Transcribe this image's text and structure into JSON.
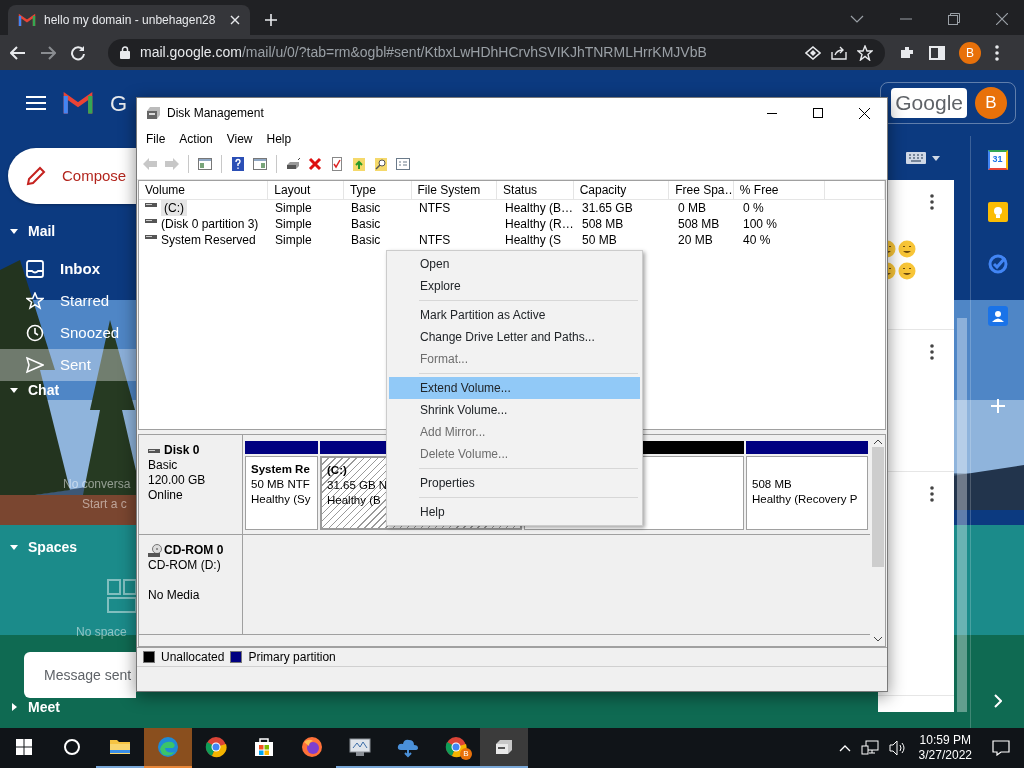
{
  "browser": {
    "tab_title": "hello my domain - unbehagen28",
    "url_host": "mail.google.com",
    "url_path": "/mail/u/0/?tab=rm&ogbl#sent/KtbxLwHDhHCrvhSVIKJhTNRMLHrrKMJVbB",
    "profile": "B"
  },
  "gmail": {
    "logo_text": "G",
    "compose": "Compose",
    "google_badge": "Google",
    "avatar": "B",
    "calendar_day": "31",
    "toast": "Message sent",
    "sidebar": [
      {
        "kind": "section",
        "label": "Mail",
        "expanded": true
      },
      {
        "kind": "nav",
        "label": "Inbox",
        "unread": true,
        "selected": false
      },
      {
        "kind": "nav",
        "label": "Starred",
        "unread": false,
        "selected": false
      },
      {
        "kind": "nav",
        "label": "Snoozed",
        "unread": false,
        "selected": false
      },
      {
        "kind": "nav",
        "label": "Sent",
        "unread": false,
        "selected": true
      },
      {
        "kind": "section",
        "label": "Chat",
        "expanded": true
      },
      {
        "kind": "empty",
        "label": "No conversa"
      },
      {
        "kind": "link",
        "label": "Start a c"
      },
      {
        "kind": "section",
        "label": "Spaces",
        "expanded": true
      },
      {
        "kind": "empty",
        "label": "No space",
        "illustration": true
      },
      {
        "kind": "section",
        "label": "Meet",
        "expanded": false
      }
    ]
  },
  "disk_management": {
    "title": "Disk Management",
    "menu": [
      "File",
      "Action",
      "View",
      "Help"
    ],
    "toolbar": [
      {
        "kind": "icon",
        "disabled": true
      },
      {
        "kind": "icon",
        "disabled": true
      },
      {
        "kind": "separator"
      },
      {
        "kind": "icon",
        "disabled": false
      },
      {
        "kind": "separator"
      },
      {
        "kind": "icon",
        "disabled": false
      },
      {
        "kind": "icon",
        "disabled": false
      },
      {
        "kind": "separator"
      },
      {
        "kind": "icon",
        "disabled": false
      },
      {
        "kind": "icon",
        "disabled": false
      },
      {
        "kind": "icon",
        "disabled": false
      },
      {
        "kind": "icon",
        "disabled": false
      },
      {
        "kind": "icon",
        "disabled": false
      },
      {
        "kind": "icon",
        "disabled": false
      }
    ],
    "columns": [
      "Volume",
      "Layout",
      "Type",
      "File System",
      "Status",
      "Capacity",
      "Free Spa…",
      "% Free"
    ],
    "rows": [
      {
        "selected": true,
        "cells": [
          "(C:)",
          "Simple",
          "Basic",
          "NTFS",
          "Healthy (B…",
          "31.65 GB",
          "0 MB",
          "0 %"
        ]
      },
      {
        "selected": false,
        "cells": [
          "(Disk 0 partition 3)",
          "Simple",
          "Basic",
          "",
          "Healthy (R…",
          "508 MB",
          "508 MB",
          "100 %"
        ]
      },
      {
        "selected": false,
        "cells": [
          "System Reserved",
          "Simple",
          "Basic",
          "NTFS",
          "Healthy (S",
          "50 MB",
          "20 MB",
          "40 %"
        ]
      }
    ],
    "disks": [
      {
        "kind": "disk",
        "name": "Disk 0",
        "type": "Basic",
        "size": "120.00 GB",
        "status": "Online",
        "partitions": [
          {
            "kind": "primary",
            "selected": false,
            "title": "System Re",
            "lines": [
              "50 MB NTF",
              "Healthy (Sy"
            ]
          },
          {
            "kind": "primary",
            "selected": true,
            "title": "(C:)",
            "lines": [
              "31.65 GB N",
              "Healthy (B"
            ]
          },
          {
            "kind": "unallocated",
            "selected": false
          },
          {
            "kind": "primary",
            "selected": false,
            "lines": [
              "508 MB",
              "Healthy (Recovery P"
            ]
          }
        ]
      },
      {
        "kind": "cdrom",
        "name": "CD-ROM 0",
        "type": "CD-ROM (D:)",
        "status": "No Media"
      }
    ],
    "legend": [
      {
        "label": "Unallocated",
        "color": "#000000"
      },
      {
        "label": "Primary partition",
        "color": "#000080"
      }
    ],
    "context_menu": [
      {
        "kind": "item",
        "label": "Open",
        "disabled": false,
        "selected": false
      },
      {
        "kind": "item",
        "label": "Explore",
        "disabled": false,
        "selected": false
      },
      {
        "kind": "separator"
      },
      {
        "kind": "item",
        "label": "Mark Partition as Active",
        "disabled": false,
        "selected": false
      },
      {
        "kind": "item",
        "label": "Change Drive Letter and Paths...",
        "disabled": false,
        "selected": false
      },
      {
        "kind": "item",
        "label": "Format...",
        "disabled": true,
        "selected": false
      },
      {
        "kind": "separator"
      },
      {
        "kind": "item",
        "label": "Extend Volume...",
        "disabled": false,
        "selected": true
      },
      {
        "kind": "item",
        "label": "Shrink Volume...",
        "disabled": false,
        "selected": false
      },
      {
        "kind": "item",
        "label": "Add Mirror...",
        "disabled": true,
        "selected": false
      },
      {
        "kind": "item",
        "label": "Delete Volume...",
        "disabled": true,
        "selected": false
      },
      {
        "kind": "separator"
      },
      {
        "kind": "item",
        "label": "Properties",
        "disabled": false,
        "selected": false
      },
      {
        "kind": "separator"
      },
      {
        "kind": "item",
        "label": "Help",
        "disabled": false,
        "selected": false
      }
    ]
  },
  "taskbar": {
    "apps": [
      {
        "running": true,
        "hovered": false,
        "selected": false
      },
      {
        "running": true,
        "hovered": true,
        "selected": false
      },
      {
        "running": false,
        "hovered": false,
        "selected": false
      },
      {
        "running": false,
        "hovered": false,
        "selected": false
      },
      {
        "running": false,
        "hovered": false,
        "selected": false
      },
      {
        "running": true,
        "hovered": false,
        "selected": false
      },
      {
        "running": true,
        "hovered": false,
        "selected": false
      },
      {
        "running": true,
        "hovered": false,
        "selected": false,
        "badge": "B"
      },
      {
        "running": true,
        "hovered": false,
        "selected": true
      }
    ],
    "time": "10:59 PM",
    "date": "3/27/2022"
  }
}
